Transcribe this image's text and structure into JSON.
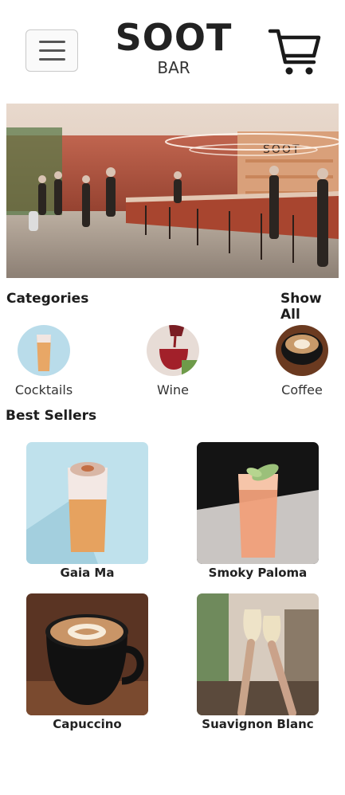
{
  "header": {
    "brand_name": "SOOT",
    "brand_sub": "BAR"
  },
  "hero": {
    "sign_text": "SOOT"
  },
  "categories": {
    "title": "Categories",
    "show_all": "Show All",
    "items": [
      {
        "label": "Cocktails"
      },
      {
        "label": "Wine"
      },
      {
        "label": "Coffee"
      }
    ]
  },
  "best_sellers": {
    "title": "Best Sellers",
    "items": [
      {
        "name": "Gaia Ma"
      },
      {
        "name": "Smoky Paloma"
      },
      {
        "name": "Capuccino"
      },
      {
        "name": "Suavignon Blanc"
      }
    ]
  },
  "colors": {
    "text": "#1d1d1d",
    "border": "#c9c9c9",
    "bar_wall": "#b5523c"
  },
  "icons": [
    "menu-icon",
    "cart-icon"
  ]
}
